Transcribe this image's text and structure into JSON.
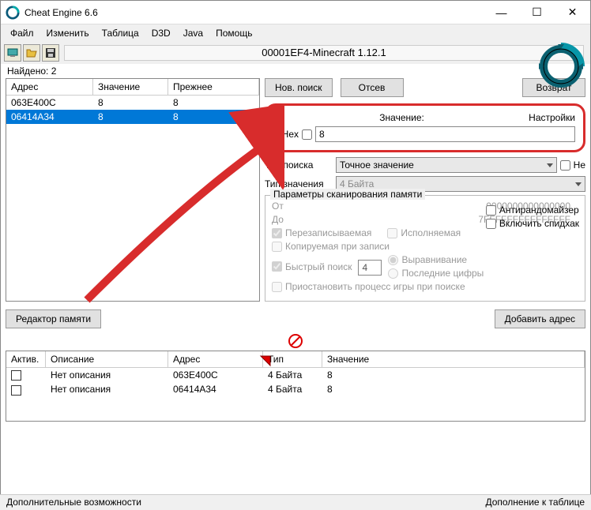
{
  "titlebar": {
    "title": "Cheat Engine 6.6"
  },
  "window_controls": {
    "min": "—",
    "max": "☐",
    "close": "✕"
  },
  "menu": [
    "Файл",
    "Изменить",
    "Таблица",
    "D3D",
    "Java",
    "Помощь"
  ],
  "toolbar": {
    "process_label": "00001EF4-Minecraft 1.12.1"
  },
  "found": {
    "label": "Найдено:",
    "count": "2"
  },
  "results": {
    "headers": [
      "Адрес",
      "Значение",
      "Прежнее"
    ],
    "rows": [
      {
        "addr": "063E400C",
        "val": "8",
        "prev": "8",
        "selected": false
      },
      {
        "addr": "06414A34",
        "val": "8",
        "prev": "8",
        "selected": true
      }
    ]
  },
  "buttons": {
    "new_scan": "Нов. поиск",
    "next_scan": "Отсев",
    "undo": "Возврат",
    "memory_view": "Редактор памяти",
    "add_address": "Добавить адрес"
  },
  "value_section": {
    "label": "Значение:",
    "hex_label": "Hex",
    "value": "8",
    "settings": "Настройки"
  },
  "scan": {
    "type_label": "Тип поиска",
    "type_value": "Точное значение",
    "value_type_label": "Тип значения",
    "value_type_value": "4 Байта",
    "not_label": "Не"
  },
  "scan_params": {
    "title": "Параметры сканирования памяти",
    "from_label": "От",
    "from_value": "0000000000000000",
    "to_label": "До",
    "to_value": "7FFFFFFFFFFFFFFF",
    "writable": "Перезаписываемая",
    "executable": "Исполняемая",
    "cow": "Копируемая при записи",
    "fast": "Быстрый поиск",
    "fast_val": "4",
    "alignment": "Выравнивание",
    "last_digits": "Последние цифры",
    "pause": "Приостановить процесс игры при поиске"
  },
  "side_opts": {
    "anti_random": "Антирандомайзер",
    "speedhack": "Включить спидхак"
  },
  "address_table": {
    "headers": [
      "Актив.",
      "Описание",
      "Адрес",
      "Тип",
      "Значение"
    ],
    "rows": [
      {
        "desc": "Нет описания",
        "addr": "063E400C",
        "type": "4 Байта",
        "val": "8"
      },
      {
        "desc": "Нет описания",
        "addr": "06414A34",
        "type": "4 Байта",
        "val": "8"
      }
    ]
  },
  "status": {
    "left": "Дополнительные возможности",
    "right": "Дополнение к таблице"
  }
}
